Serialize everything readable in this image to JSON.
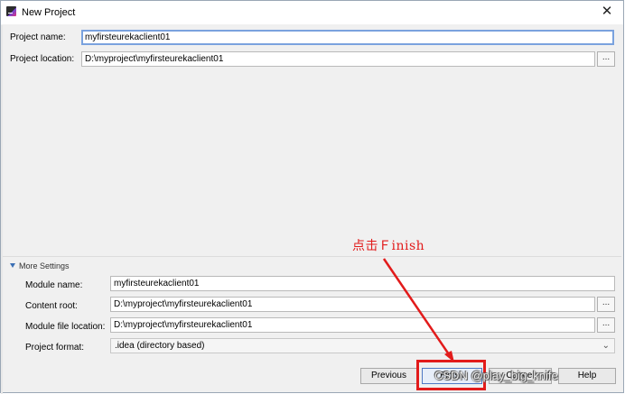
{
  "window": {
    "title": "New Project"
  },
  "project": {
    "name_label": "Project name:",
    "name_value": "myfirsteurekaclient01",
    "location_label": "Project location:",
    "location_value": "D:\\myproject\\myfirsteurekaclient01",
    "browse_label": "..."
  },
  "more_settings": {
    "header": "More Settings",
    "module_name_label": "Module name:",
    "module_name_value": "myfirsteurekaclient01",
    "content_root_label": "Content root:",
    "content_root_value": "D:\\myproject\\myfirsteurekaclient01",
    "module_file_label": "Module file location:",
    "module_file_value": "D:\\myproject\\myfirsteurekaclient01",
    "project_format_label": "Project format:",
    "project_format_value": ".idea (directory based)",
    "browse_label": "..."
  },
  "buttons": {
    "previous": "Previous",
    "finish": "Finish",
    "cancel": "Cancel",
    "help": "Help"
  },
  "annotation": {
    "text": "点击Ｆinish",
    "color": "#e21b1b"
  },
  "watermark": "CSDN @play_big_knife",
  "icons": {
    "app": "intellij-icon",
    "close": "close-icon",
    "expand": "triangle-down-icon",
    "dropdown": "chevron-down-icon"
  }
}
